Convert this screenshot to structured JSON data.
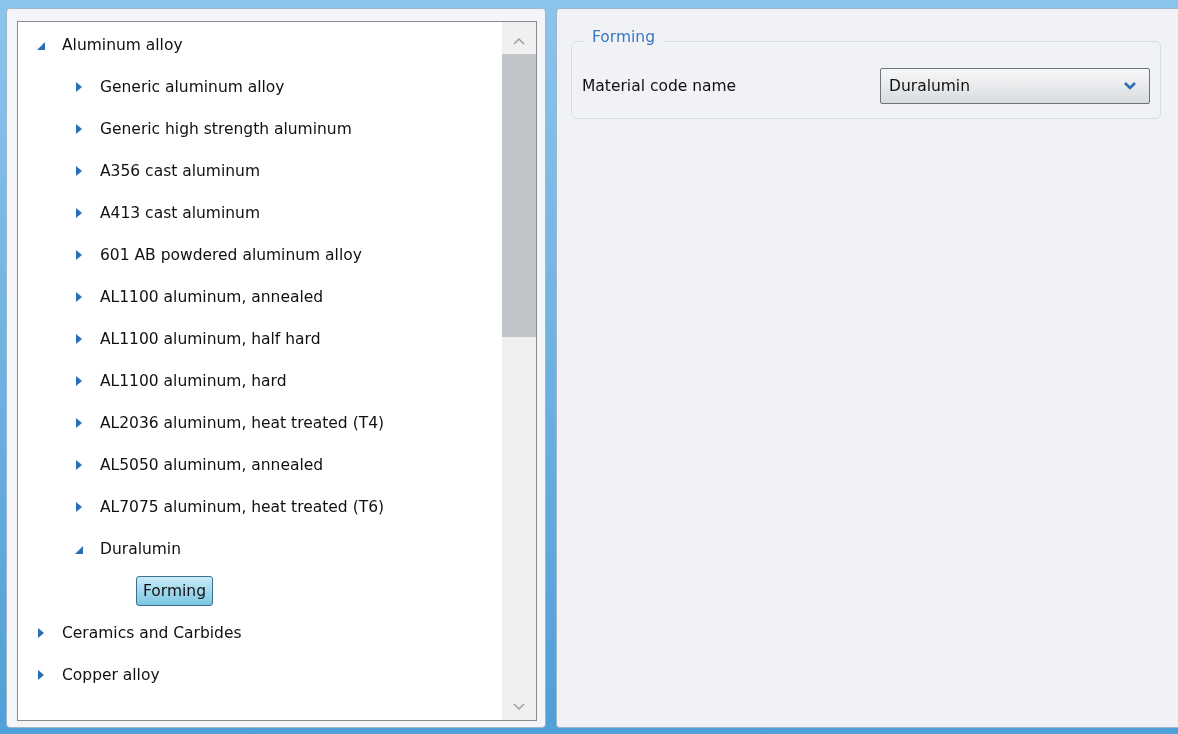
{
  "tree": [
    {
      "label": "Aluminum alloy",
      "expanded": true,
      "selected": false,
      "children": [
        {
          "label": "Generic aluminum alloy",
          "expanded": false,
          "selected": false
        },
        {
          "label": "Generic high strength aluminum",
          "expanded": false,
          "selected": false
        },
        {
          "label": "A356 cast aluminum",
          "expanded": false,
          "selected": false
        },
        {
          "label": "A413 cast aluminum",
          "expanded": false,
          "selected": false
        },
        {
          "label": "601 AB powdered aluminum alloy",
          "expanded": false,
          "selected": false
        },
        {
          "label": "AL1100 aluminum, annealed",
          "expanded": false,
          "selected": false
        },
        {
          "label": "AL1100 aluminum, half hard",
          "expanded": false,
          "selected": false
        },
        {
          "label": "AL1100 aluminum, hard",
          "expanded": false,
          "selected": false
        },
        {
          "label": "AL2036 aluminum, heat treated (T4)",
          "expanded": false,
          "selected": false
        },
        {
          "label": "AL5050 aluminum, annealed",
          "expanded": false,
          "selected": false
        },
        {
          "label": "AL7075 aluminum, heat treated (T6)",
          "expanded": false,
          "selected": false
        },
        {
          "label": "Duralumin",
          "expanded": true,
          "selected": false,
          "children": [
            {
              "label": "Forming",
              "selected": true
            }
          ]
        }
      ]
    },
    {
      "label": "Ceramics and Carbides",
      "expanded": false,
      "selected": false
    },
    {
      "label": "Copper alloy",
      "expanded": false,
      "selected": false
    }
  ],
  "group": {
    "title": "Forming",
    "field_label": "Material code name",
    "value": "Duralumin"
  }
}
